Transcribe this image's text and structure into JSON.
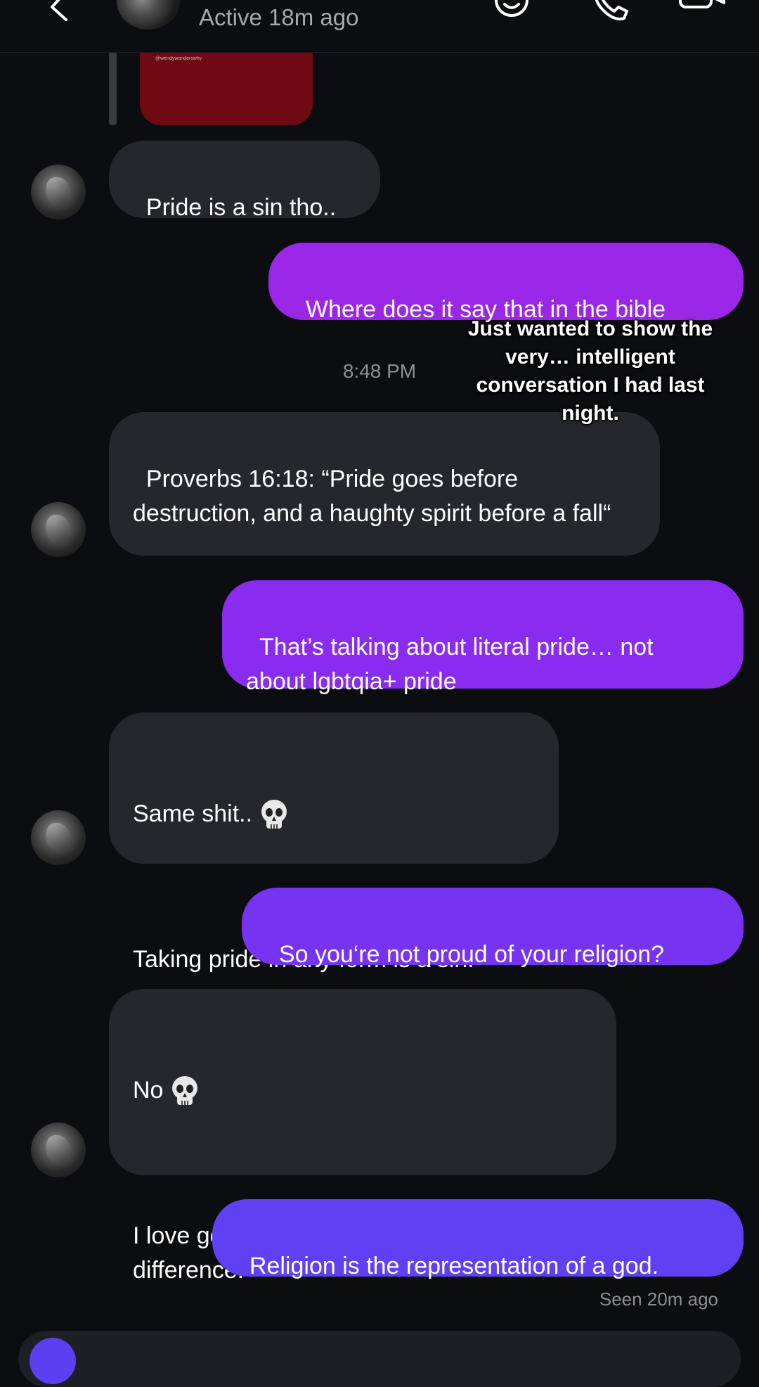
{
  "header": {
    "status": "Active 18m ago"
  },
  "shared_post": {
    "handle": "@wendywonderswhy"
  },
  "messages": [
    {
      "dir": "in",
      "text": "Pride is a sin tho.."
    },
    {
      "dir": "out",
      "text": "Where does it say that in the bible"
    },
    {
      "dir": "in",
      "text": "Proverbs 16:18: “Pride goes before destruction, and a haughty spirit before a fall“"
    },
    {
      "dir": "out",
      "text": "That’s talking about literal pride… not about lgbtqia+ pride"
    },
    {
      "dir": "in",
      "text": "Same shit..",
      "emoji": "skull-icon",
      "text2": "Taking pride in any form is a sin!"
    },
    {
      "dir": "out",
      "text": "So you‘re not proud of your religion?"
    },
    {
      "dir": "in",
      "text": "No",
      "emoji": "skull-icon",
      "text2": "I love god, not my religion. There’s a difference!"
    },
    {
      "dir": "out",
      "text": "Religion is the representation of a god."
    }
  ],
  "timestamp": "8:48 PM",
  "overlay_caption": "Just wanted to show the very… intelligent conversation I had last night.",
  "seen": "Seen 20m ago",
  "colors": {
    "background": "#0c0d10",
    "incoming_bubble": "#26272c",
    "outgoing_1": "#9a26e6",
    "outgoing_2": "#8a2cf0",
    "outgoing_3": "#7634f2",
    "outgoing_4": "#6a3af5",
    "outgoing_5": "#6040f3",
    "secondary_text": "#8e8e93"
  }
}
